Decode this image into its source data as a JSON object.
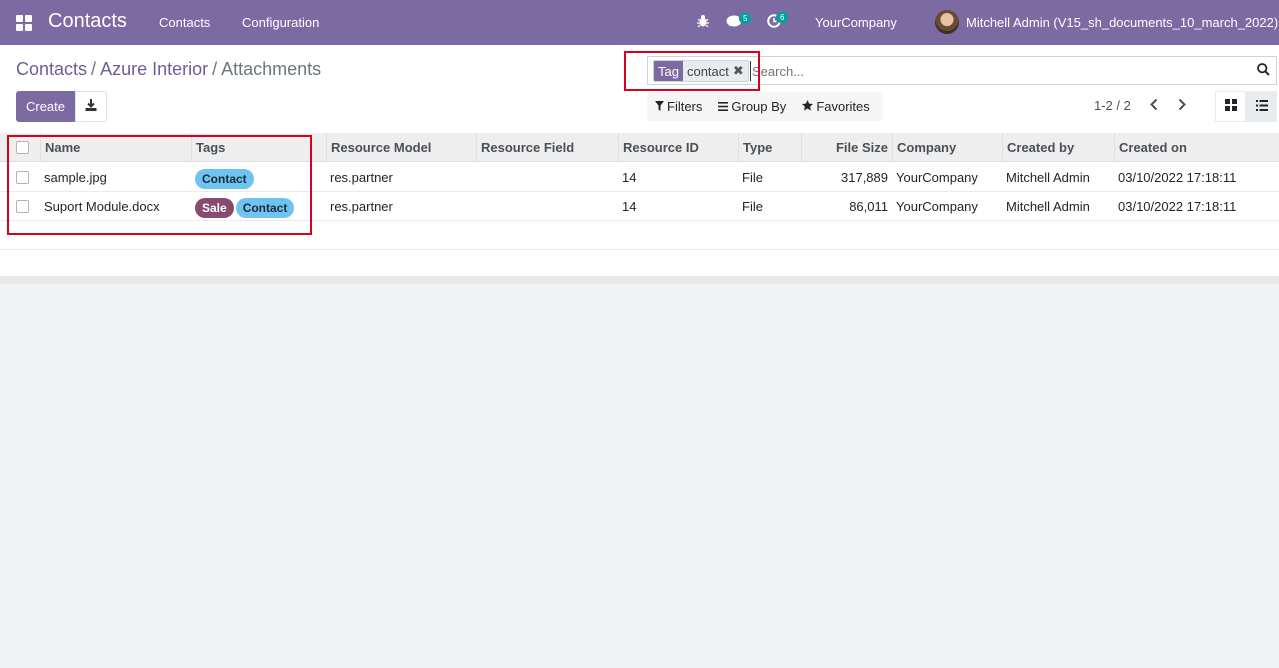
{
  "navbar": {
    "app_title": "Contacts",
    "menu": [
      "Contacts",
      "Configuration"
    ],
    "messages_count": "5",
    "activities_count": "6",
    "company": "YourCompany",
    "user": "Mitchell Admin (V15_sh_documents_10_march_2022)"
  },
  "breadcrumb": {
    "items": [
      "Contacts",
      "Azure Interior"
    ],
    "current": "Attachments"
  },
  "buttons": {
    "create": "Create"
  },
  "search": {
    "facet_label": "Tag",
    "facet_value": "contact",
    "placeholder": "Search..."
  },
  "filters": {
    "filters": "Filters",
    "group_by": "Group By",
    "favorites": "Favorites"
  },
  "pager": {
    "text": "1-2 / 2"
  },
  "table": {
    "columns": [
      "Name",
      "Tags",
      "Resource Model",
      "Resource Field",
      "Resource ID",
      "Type",
      "File Size",
      "Company",
      "Created by",
      "Created on"
    ],
    "rows": [
      {
        "name": "sample.jpg",
        "tags": [
          "Contact"
        ],
        "resource_model": "res.partner",
        "resource_field": "",
        "resource_id": "14",
        "type": "File",
        "file_size": "317,889",
        "company": "YourCompany",
        "created_by": "Mitchell Admin",
        "created_on": "03/10/2022 17:18:11"
      },
      {
        "name": "Suport Module.docx",
        "tags": [
          "Sale",
          "Contact"
        ],
        "resource_model": "res.partner",
        "resource_field": "",
        "resource_id": "14",
        "type": "File",
        "file_size": "86,011",
        "company": "YourCompany",
        "created_by": "Mitchell Admin",
        "created_on": "03/10/2022 17:18:11"
      }
    ]
  },
  "colors": {
    "brand": "#7c6aa3",
    "tag_contact": "#6ec3f0",
    "tag_sale": "#8a4a6e",
    "annotation": "#d9001b"
  },
  "icons": {
    "apps": "apps-grid-icon",
    "debug": "bug-icon",
    "messages": "chat-icon",
    "activities": "clock-icon",
    "download": "download-icon",
    "search": "search-icon",
    "filter": "filter-icon",
    "group_by": "bars-icon",
    "favorites": "star-icon",
    "prev": "chevron-left-icon",
    "next": "chevron-right-icon",
    "kanban": "kanban-view-icon",
    "list": "list-view-icon"
  }
}
